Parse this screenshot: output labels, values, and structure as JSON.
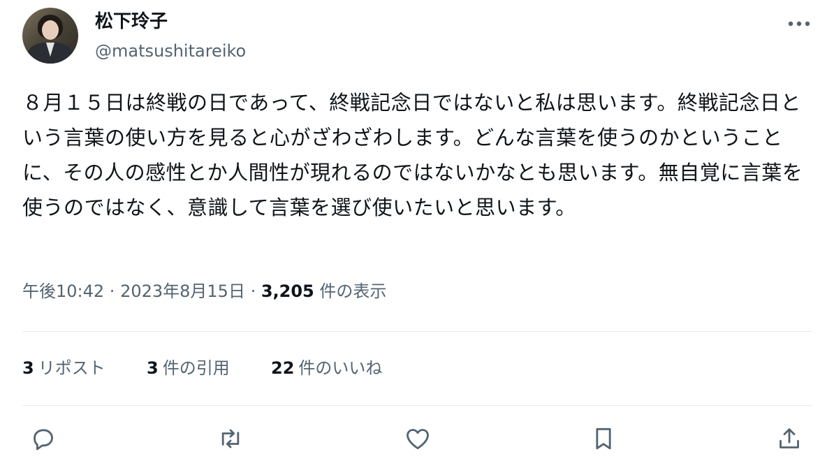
{
  "author": {
    "display_name": "松下玲子",
    "username": "@matsushitareiko"
  },
  "tweet": {
    "text": "８月１５日は終戦の日であって、終戦記念日ではないと私は思います。終戦記念日という言葉の使い方を見ると心がざわざわします。どんな言葉を使うのかということに、その人の感性とか人間性が現れるのではないかなとも思います。無自覚に言葉を使うのではなく、意識して言葉を選び使いたいと思います。",
    "time": "午後10:42",
    "separator": " · ",
    "date": "2023年8月15日",
    "views_count": "3,205",
    "views_label": " 件の表示"
  },
  "stats": {
    "reposts_count": "3",
    "reposts_label": "リポスト",
    "quotes_count": "3",
    "quotes_label": "件の引用",
    "likes_count": "22",
    "likes_label": "件のいいね"
  },
  "icons": {
    "more": "more-horizontal-icon",
    "reply": "reply-icon",
    "repost": "repost-icon",
    "like": "heart-icon",
    "bookmark": "bookmark-icon",
    "share": "share-icon"
  },
  "colors": {
    "primary_text": "#0f1419",
    "secondary_text": "#536471",
    "divider": "#e6e9eb"
  }
}
